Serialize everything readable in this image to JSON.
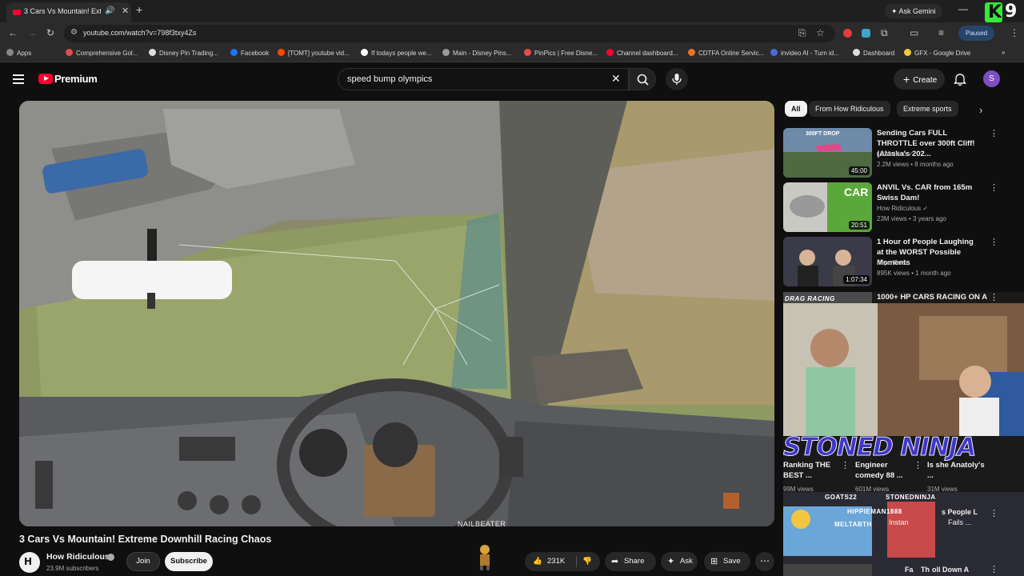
{
  "browser": {
    "tab_title": "3 Cars Vs Mountain! Extreme",
    "ask_gemini": "Ask Gemini",
    "url": "youtube.com/watch?v=798f3txy4Zs",
    "paused": "Paused",
    "k9_number": "9",
    "bookmarks": [
      "Apps",
      "Comprehensive Gol...",
      "Disney Pin Trading...",
      "Facebook",
      "[TOMT] youtube vid...",
      "If todays people we...",
      "Main - Disney Pins...",
      "PinPics | Free Disne...",
      "Channel dashboard...",
      "CDTFA Online Servic...",
      "invideo AI - Turn id...",
      "Dashboard",
      "GFX - Google Drive"
    ]
  },
  "header": {
    "premium_label": "Premium",
    "search_value": "speed bump olympics",
    "create_label": "Create",
    "avatar_letter": "S"
  },
  "video": {
    "watermark": "NAILBEATER",
    "title": "3 Cars Vs Mountain! Extreme Downhill Racing Chaos",
    "channel": "How Ridiculous",
    "subscribers": "23.9M subscribers",
    "join": "Join",
    "subscribe": "Subscribe",
    "likes": "231K",
    "share": "Share",
    "ask": "Ask",
    "save": "Save"
  },
  "chips": [
    "All",
    "From How Ridiculous",
    "Extreme sports"
  ],
  "recommendations": [
    {
      "title": "Sending Cars FULL THROTTLE over 300ft Cliff! (Alaska's 202...",
      "channel": "1320video",
      "meta": "2.2M views • 8 months ago",
      "duration": "45:00",
      "thumb_text": "300FT DROP"
    },
    {
      "title": "ANVIL Vs. CAR from 165m Swiss Dam!",
      "channel": "How Ridiculous",
      "meta": "23M views • 3 years ago",
      "duration": "20:51",
      "thumb_text": "CAR"
    },
    {
      "title": "1 Hour of People Laughing at the WORST Possible Moments",
      "channel": "Papa Ruzz",
      "meta": "895K views • 1 month ago",
      "duration": "1:07:34"
    },
    {
      "title": "1000+ HP CARS RACING ON A",
      "thumb_text": "DRAG RACING"
    }
  ],
  "overlay": {
    "stoned_ninja": "STONED NINJA",
    "shorts": [
      {
        "title": "Ranking THE BEST ...",
        "views": "99M views"
      },
      {
        "title": "Engineer comedy 88 ...",
        "views": "601M views"
      },
      {
        "title": "Is she Anatoly's ...",
        "views": "31M views"
      }
    ],
    "tags": [
      "GOATS22",
      "STONEDNINJA",
      "HIPPIEMAN1888",
      "MELTABTH"
    ],
    "partial_texts": [
      "s People L",
      "Instan",
      "Fails ...",
      "Fa",
      "Th",
      "oll Down A"
    ]
  }
}
